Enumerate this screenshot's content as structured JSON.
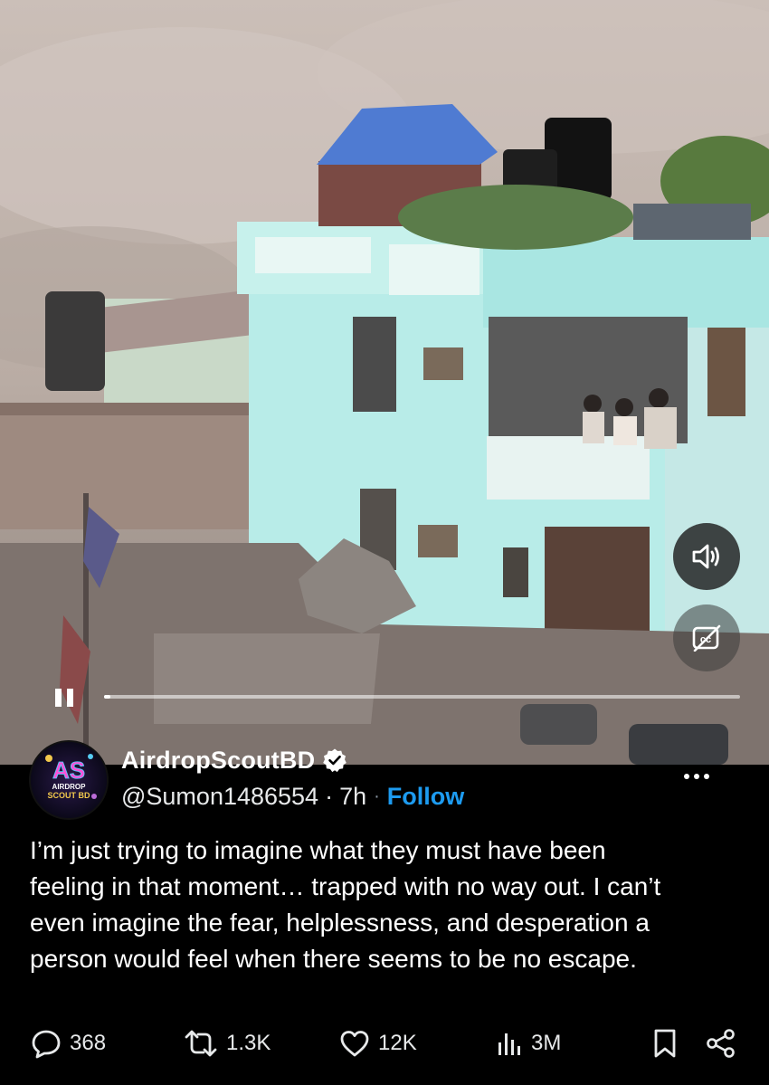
{
  "video": {
    "sound_icon": "speaker-icon",
    "cc_icon": "closed-captions-icon",
    "playback_icon": "pause-icon",
    "progress_fraction": 0.01
  },
  "tweet": {
    "display_name": "AirdropScoutBD",
    "verified_icon": "verified-badge-icon",
    "handle": "@Sumon1486554",
    "dot": "·",
    "time": "7h",
    "follow_label": "Follow",
    "avatar_text_line1": "AS",
    "avatar_text_line2": "AIRDROP",
    "avatar_text_line3": "SCOUT BD",
    "text": "I’m just trying to imagine what they must have been\nfeeling in that moment… trapped with no way out. I can’t\neven imagine the fear, helplessness, and desperation a\nperson would feel when there seems to be no escape."
  },
  "actions": {
    "replies": "368",
    "reposts": "1.3K",
    "likes": "12K",
    "views": "3M"
  },
  "colors": {
    "accent": "#1d9bf0",
    "background": "#000000",
    "building": "#b8ece8"
  }
}
